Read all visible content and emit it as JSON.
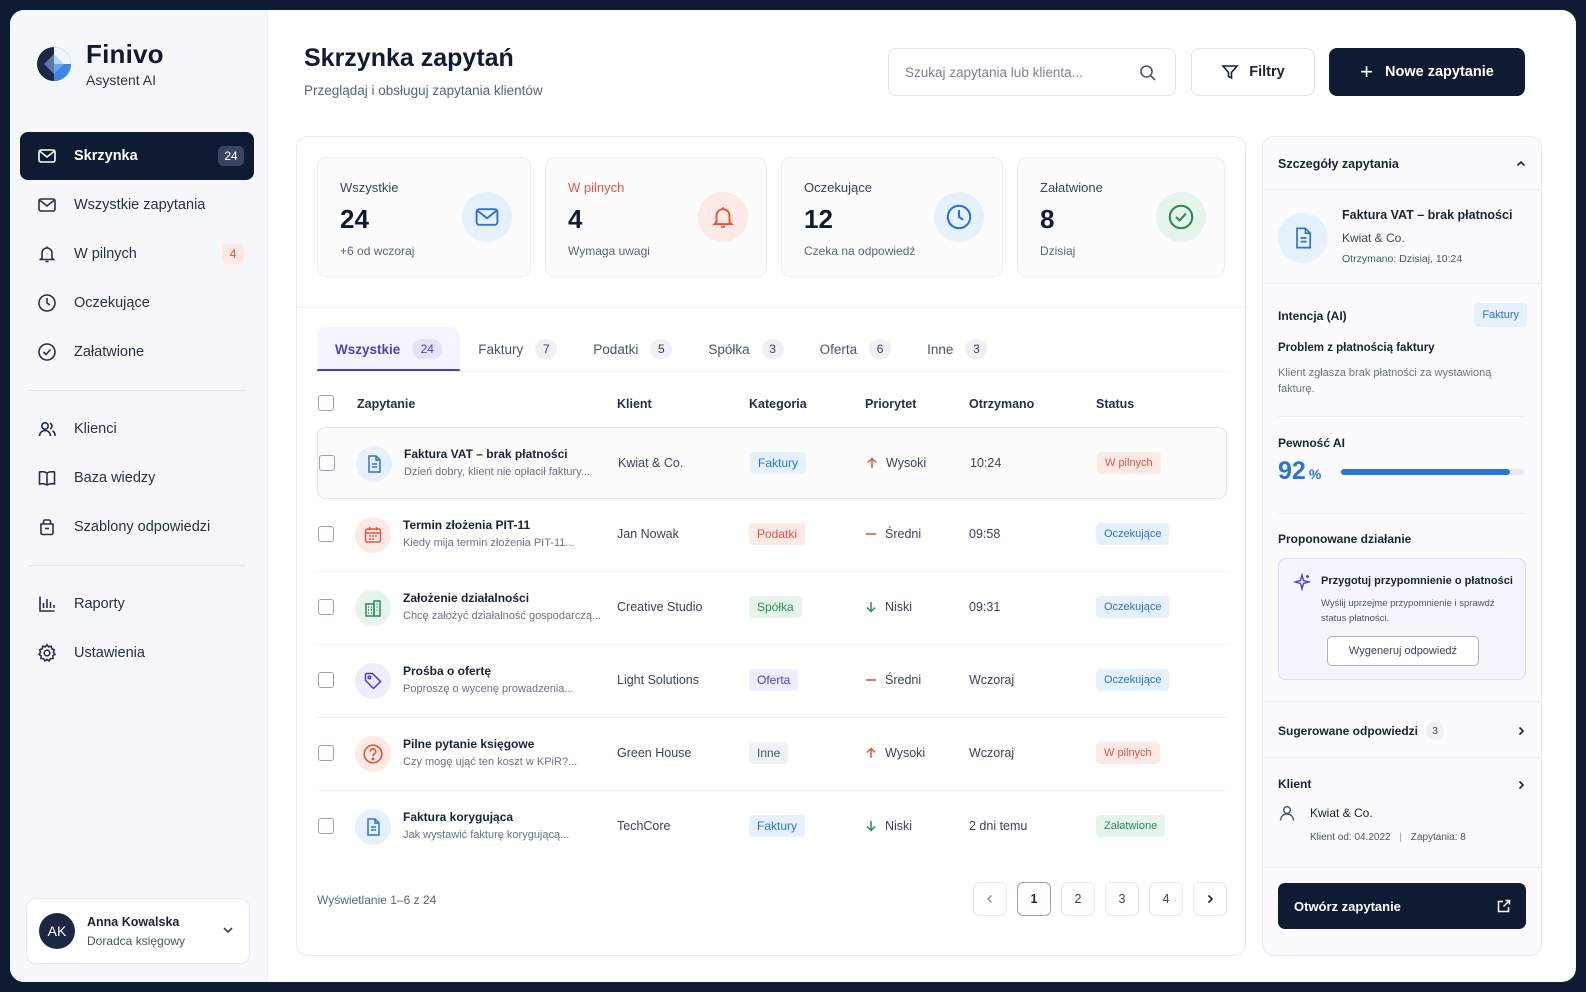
{
  "brand": {
    "name": "Finivo",
    "subtitle": "Asystent AI"
  },
  "sidebar": {
    "items": [
      {
        "label": "Skrzynka",
        "badge": "24",
        "icon": "mail-icon",
        "active": true
      },
      {
        "label": "Wszystkie zapytania",
        "icon": "mail-icon"
      },
      {
        "label": "W pilnych",
        "badge": "4",
        "icon": "bell-icon"
      },
      {
        "label": "Oczekujące",
        "icon": "clock-icon"
      },
      {
        "label": "Załatwione",
        "icon": "check-circle-icon"
      },
      {
        "label": "Klienci",
        "icon": "users-icon"
      },
      {
        "label": "Baza wiedzy",
        "icon": "book-icon"
      },
      {
        "label": "Szablony odpowiedzi",
        "icon": "template-icon"
      },
      {
        "label": "Raporty",
        "icon": "chart-icon"
      },
      {
        "label": "Ustawienia",
        "icon": "gear-icon"
      }
    ],
    "user": {
      "initials": "AK",
      "name": "Anna Kowalska",
      "role": "Doradca księgowy"
    }
  },
  "header": {
    "title": "Skrzynka zapytań",
    "subtitle": "Przeglądaj i obsługuj zapytania klientów",
    "search_placeholder": "Szukaj zapytania lub klienta...",
    "filter_label": "Filtry",
    "new_label": "Nowe zapytanie"
  },
  "stats": [
    {
      "label": "Wszystkie",
      "value": "24",
      "note": "+6 od wczoraj",
      "icon": "mail-icon",
      "color": "#2a74d8"
    },
    {
      "label": "W pilnych",
      "value": "4",
      "note": "Wymaga uwagi",
      "icon": "bell-icon",
      "color": "#e0553c"
    },
    {
      "label": "Oczekujące",
      "value": "12",
      "note": "Czeka na odpowiedź",
      "icon": "clock-icon",
      "color": "#2a74d8"
    },
    {
      "label": "Załatwione",
      "value": "8",
      "note": "Dzisiaj",
      "icon": "check-circle-icon",
      "color": "#2d8a56"
    }
  ],
  "tabs": [
    {
      "label": "Wszystkie",
      "count": "24",
      "active": true
    },
    {
      "label": "Faktury",
      "count": "7"
    },
    {
      "label": "Podatki",
      "count": "5"
    },
    {
      "label": "Spółka",
      "count": "3"
    },
    {
      "label": "Oferta",
      "count": "6"
    },
    {
      "label": "Inne",
      "count": "3"
    }
  ],
  "table": {
    "columns": [
      "Zapytanie",
      "Klient",
      "Kategoria",
      "Priorytet",
      "Otrzymano",
      "Status"
    ],
    "rows": [
      {
        "title": "Faktura VAT – brak płatności",
        "desc": "Dzień dobry, klient nie opłacił faktury...",
        "client": "Kwiat & Co.",
        "category": "Faktury",
        "priority": "Wysoki",
        "received": "10:24",
        "status": "W pilnych",
        "icon": "document-icon"
      },
      {
        "title": "Termin złożenia PIT-11",
        "desc": "Kiedy mija termin złożenia PIT-11...",
        "client": "Jan Nowak",
        "category": "Podatki",
        "priority": "Średni",
        "received": "09:58",
        "status": "Oczekujące",
        "icon": "calendar-icon"
      },
      {
        "title": "Założenie działalności",
        "desc": "Chcę założyć działalność gospodarczą...",
        "client": "Creative Studio",
        "category": "Spółka",
        "priority": "Niski",
        "received": "09:31",
        "status": "Oczekujące",
        "icon": "building-icon"
      },
      {
        "title": "Prośba o ofertę",
        "desc": "Poproszę o wycenę prowadzenia...",
        "client": "Light Solutions",
        "category": "Oferta",
        "priority": "Średni",
        "received": "Wczoraj",
        "status": "Oczekujące",
        "icon": "tag-icon"
      },
      {
        "title": "Pilne pytanie księgowe",
        "desc": "Czy mogę ująć ten koszt w KPiR?...",
        "client": "Green House",
        "category": "Inne",
        "priority": "Wysoki",
        "received": "Wczoraj",
        "status": "W pilnych",
        "icon": "question-icon"
      },
      {
        "title": "Faktura korygująca",
        "desc": "Jak wystawić fakturę korygującą...",
        "client": "TechCore",
        "category": "Faktury",
        "priority": "Niski",
        "received": "2 dni temu",
        "status": "Załatwione",
        "icon": "document-icon"
      }
    ],
    "footer": "Wyświetlanie 1–6 z 24",
    "pages": [
      "1",
      "2",
      "3",
      "4"
    ]
  },
  "detail": {
    "heading": "Szczegóły zapytania",
    "title": "Faktura VAT – brak płatności",
    "client": "Kwiat & Co.",
    "received": "Otrzymano: Dzisiaj, 10:24",
    "intent_label": "Intencja (AI)",
    "intent_tag": "Faktury",
    "problem": "Problem z płatnością faktury",
    "problem_desc": "Klient zgłasza brak płatności za wystawioną fakturę.",
    "confidence_label": "Pewność AI",
    "confidence_value": "92",
    "confidence_unit": "%",
    "confidence_fraction": 0.92,
    "action_label": "Proponowane działanie",
    "action_title": "Przygotuj przypomnienie o płatności",
    "action_desc": "Wyślij uprzejme przypomnienie i sprawdź status płatności.",
    "generate_label": "Wygeneruj odpowiedź",
    "suggested_label": "Sugerowane odpowiedzi",
    "suggested_count": "3",
    "client_label": "Klient",
    "client_name": "Kwiat & Co.",
    "client_since": "Klient od: 04.2022",
    "client_requests": "Zapytania: 8",
    "open_label": "Otwórz zapytanie"
  }
}
